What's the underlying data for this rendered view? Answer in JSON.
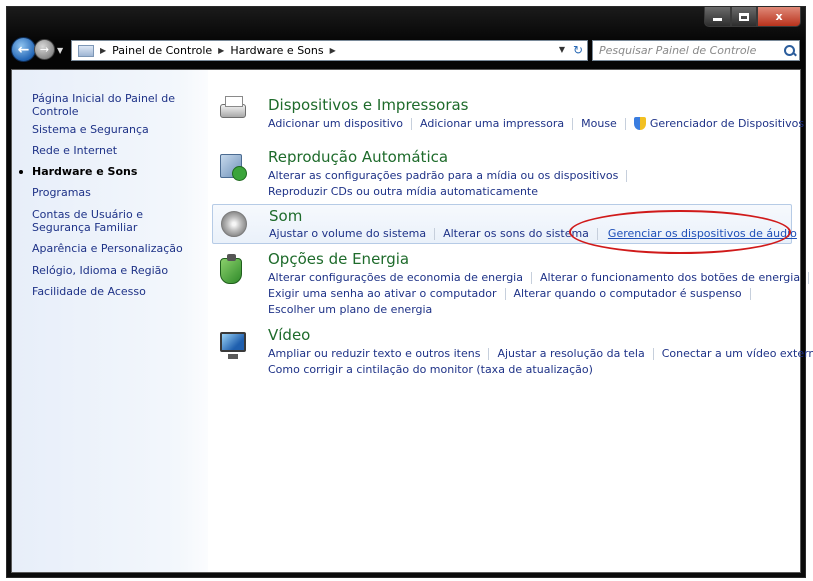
{
  "window": {
    "caption": {
      "minimize": "minimize",
      "maximize": "maximize",
      "close": "x"
    }
  },
  "address_bar": {
    "breadcrumbs": [
      "Painel de Controle",
      "Hardware e Sons"
    ],
    "search_placeholder": "Pesquisar Painel de Controle"
  },
  "sidebar": {
    "items": [
      {
        "label": "Página Inicial do Painel de Controle",
        "active": false
      },
      {
        "label": "Sistema e Segurança",
        "active": false
      },
      {
        "label": "Rede e Internet",
        "active": false
      },
      {
        "label": "Hardware e Sons",
        "active": true
      },
      {
        "label": "Programas",
        "active": false
      },
      {
        "label": "Contas de Usuário e Segurança Familiar",
        "active": false
      },
      {
        "label": "Aparência e Personalização",
        "active": false
      },
      {
        "label": "Relógio, Idioma e Região",
        "active": false
      },
      {
        "label": "Facilidade de Acesso",
        "active": false
      }
    ]
  },
  "categories": [
    {
      "title": "Dispositivos e Impressoras",
      "icon": "printer-icon",
      "lines": [
        [
          "Adicionar um dispositivo",
          "Adicionar uma impressora",
          "Mouse",
          "Gerenciador de Dispositivos"
        ]
      ]
    },
    {
      "title": "Reprodução Automática",
      "icon": "autoplay-icon",
      "lines": [
        [
          "Alterar as configurações padrão para a mídia ou os dispositivos"
        ],
        [
          "Reproduzir CDs ou outra mídia automaticamente"
        ]
      ]
    },
    {
      "title": "Som",
      "icon": "speaker-icon",
      "highlighted": true,
      "lines": [
        [
          "Ajustar o volume do sistema",
          "Alterar os sons do sistema",
          "Gerenciar os dispositivos de áudio"
        ]
      ]
    },
    {
      "title": "Opções de Energia",
      "icon": "power-options-icon",
      "lines": [
        [
          "Alterar configurações de economia de energia",
          "Alterar o funcionamento dos botões de energia"
        ],
        [
          "Exigir uma senha ao ativar o computador",
          "Alterar quando o computador é suspenso"
        ],
        [
          "Escolher um plano de energia"
        ]
      ]
    },
    {
      "title": "Vídeo",
      "icon": "display-icon",
      "lines": [
        [
          "Ampliar ou reduzir texto e outros itens",
          "Ajustar a resolução da tela",
          "Conectar a um vídeo externo"
        ],
        [
          "Como corrigir a cintilação do monitor (taxa de atualização)"
        ]
      ]
    }
  ],
  "colors": {
    "link": "#1e3287",
    "category_title": "#1e6b2b",
    "annotation_ellipse": "#d01a1a",
    "sidebar_bg": "#e7eef9"
  }
}
